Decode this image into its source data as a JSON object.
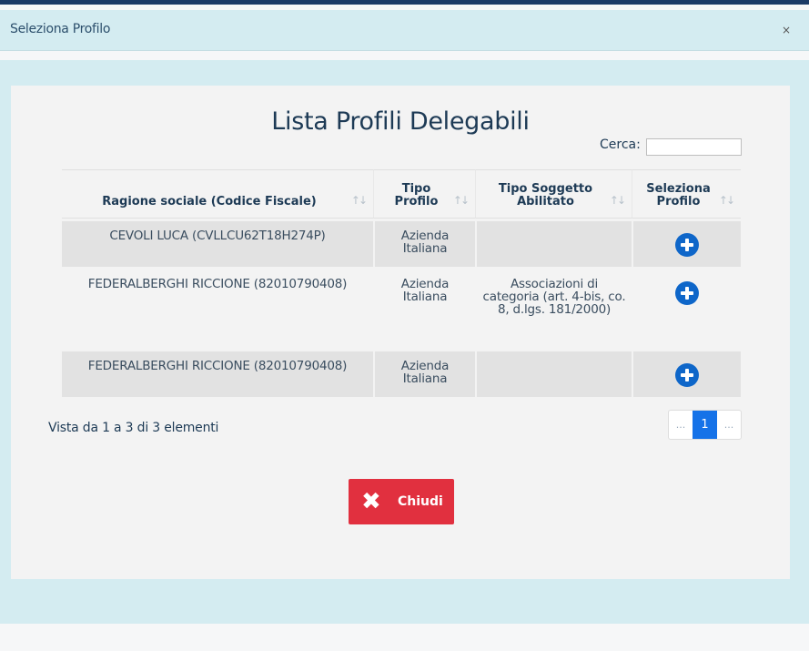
{
  "dialog": {
    "title": "Seleziona Profilo",
    "close_glyph": "×"
  },
  "panel": {
    "title": "Lista Profili Delegabili",
    "search": {
      "label": "Cerca:",
      "value": "",
      "placeholder": ""
    }
  },
  "table": {
    "columns": [
      "Ragione sociale (Codice Fiscale)",
      "Tipo Profilo",
      "Tipo Soggetto Abilitato",
      "Seleziona Profilo"
    ],
    "sort_glyph": "↑↓",
    "rows": [
      {
        "ragione": "CEVOLI LUCA (CVLLCU62T18H274P)",
        "tipo_profilo": "Azienda Italiana",
        "tipo_soggetto": "",
        "action_icon": "plus-circle-icon"
      },
      {
        "ragione": "FEDERALBERGHI RICCIONE (82010790408)",
        "tipo_profilo": "Azienda Italiana",
        "tipo_soggetto": "Associazioni di categoria (art. 4-bis, co. 8, d.lgs. 181/2000)",
        "action_icon": "plus-circle-icon"
      },
      {
        "ragione": "FEDERALBERGHI RICCIONE (82010790408)",
        "tipo_profilo": "Azienda Italiana",
        "tipo_soggetto": "",
        "action_icon": "plus-circle-icon"
      }
    ]
  },
  "footer": {
    "info": "Vista da 1 a 3 di 3 elementi",
    "pagination": {
      "prev": "...",
      "current": "1",
      "next": "..."
    }
  },
  "close_button": {
    "label": "Chiudi",
    "icon": "close-x-icon",
    "icon_glyph": "✖"
  },
  "colors": {
    "header_bg": "#d4ecf1",
    "panel_bg": "#f3f3f3",
    "accent_blue": "#1572e8",
    "danger_red": "#e1303f"
  }
}
